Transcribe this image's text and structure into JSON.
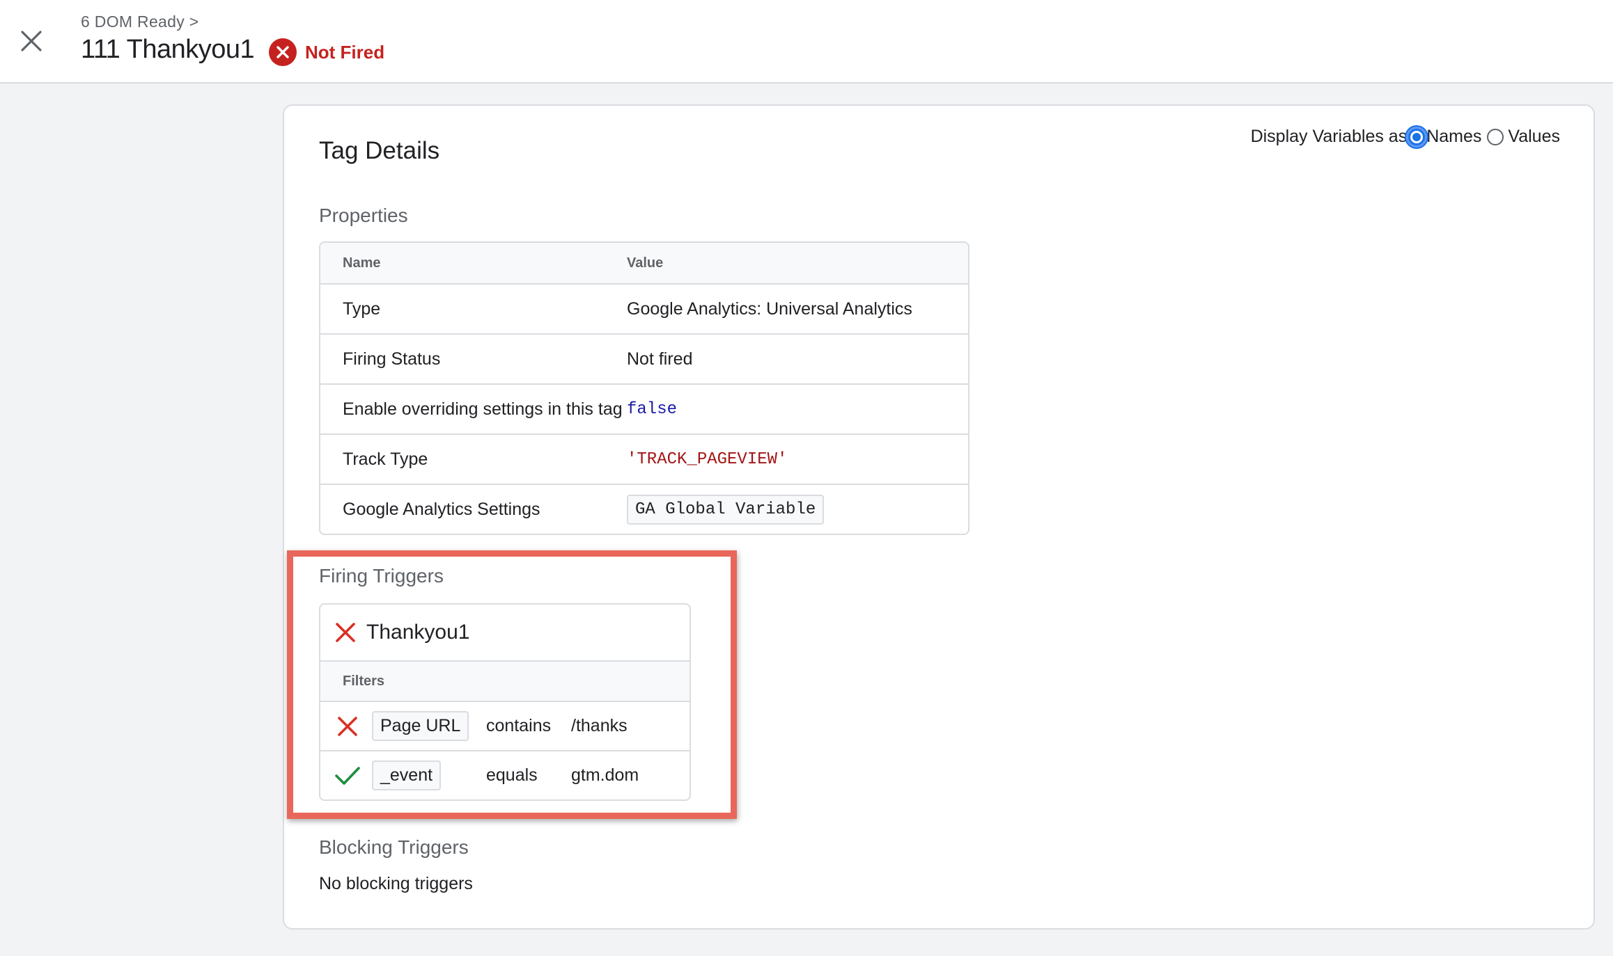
{
  "header": {
    "breadcrumb": "6 DOM Ready >",
    "tag_title": "111 Thankyou1",
    "status": "Not Fired",
    "status_color": "#c5221f"
  },
  "panel": {
    "title": "Tag Details",
    "display_vars": {
      "label": "Display Variables as",
      "option_names": "Names",
      "option_values": "Values",
      "selected": "Names"
    },
    "properties": {
      "section_label": "Properties",
      "col_name": "Name",
      "col_value": "Value",
      "rows": [
        {
          "name": "Type",
          "value": "Google Analytics: Universal Analytics"
        },
        {
          "name": "Firing Status",
          "value": "Not fired"
        },
        {
          "name": "Enable overriding settings in this tag",
          "value": "false"
        },
        {
          "name": "Track Type",
          "value": "'TRACK_PAGEVIEW'"
        },
        {
          "name": "Google Analytics Settings",
          "value": "GA Global Variable"
        }
      ]
    },
    "firing_triggers": {
      "section_label": "Firing Triggers",
      "trigger_name": "Thankyou1",
      "trigger_status_icon": "close-icon",
      "filters_label": "Filters",
      "filters": [
        {
          "icon": "close-icon",
          "variable": "Page URL",
          "operator": "contains",
          "value": "/thanks"
        },
        {
          "icon": "check-icon",
          "variable": "_event",
          "operator": "equals",
          "value": "gtm.dom"
        }
      ]
    },
    "blocking_triggers": {
      "section_label": "Blocking Triggers",
      "text": "No blocking triggers"
    }
  },
  "colors": {
    "accent_blue": "#1a73e8",
    "error_red": "#c5221f",
    "success_green": "#1e8e3e",
    "highlight_box": "#e8675a"
  }
}
